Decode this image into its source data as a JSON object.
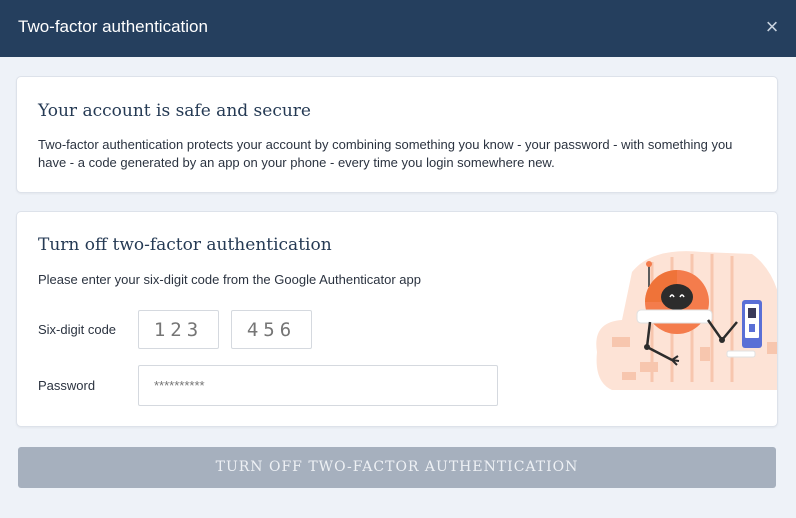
{
  "modal": {
    "title": "Two-factor authentication",
    "close_symbol": "×"
  },
  "info": {
    "heading": "Your account is safe and secure",
    "line1": "Two-factor authentication protects your account by combining something you know - your password - with something you",
    "line2": "have - a code generated by an app on your phone - every time you login somewhere new."
  },
  "form": {
    "heading": "Turn off two-factor authentication",
    "instructions": "Please enter your six-digit code from the Google Authenticator app",
    "code_label": "Six-digit code",
    "code_part1_placeholder": "123",
    "code_part2_placeholder": "456",
    "password_label": "Password",
    "password_placeholder": "**********"
  },
  "submit_label": "TURN OFF TWO-FACTOR AUTHENTICATION",
  "colors": {
    "header": "#253f5e",
    "button_disabled": "#a6b0be",
    "accent": "#f47c4c"
  }
}
